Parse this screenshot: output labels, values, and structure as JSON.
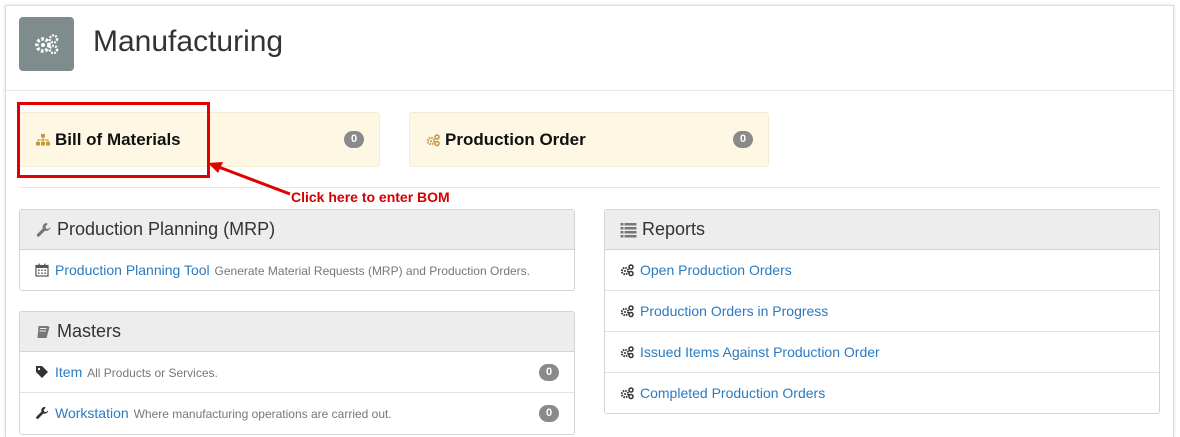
{
  "header": {
    "title": "Manufacturing",
    "icon": "gears-icon"
  },
  "shortcuts": [
    {
      "label": "Bill of Materials",
      "icon": "sitemap-icon",
      "count": "0"
    },
    {
      "label": "Production Order",
      "icon": "gears-icon",
      "count": "0"
    }
  ],
  "annotation": {
    "text": "Click here to enter BOM",
    "color": "#d40000"
  },
  "planning": {
    "title": "Production Planning (MRP)",
    "icon": "wrench-icon",
    "items": [
      {
        "label": "Production Planning Tool",
        "description": "Generate Material Requests (MRP) and Production Orders.",
        "icon": "calendar-icon"
      }
    ]
  },
  "masters": {
    "title": "Masters",
    "icon": "book-icon",
    "items": [
      {
        "label": "Item",
        "description": "All Products or Services.",
        "count": "0",
        "icon": "tag-icon"
      },
      {
        "label": "Workstation",
        "description": "Where manufacturing operations are carried out.",
        "count": "0",
        "icon": "wrench-icon"
      }
    ]
  },
  "reports": {
    "title": "Reports",
    "icon": "list-icon",
    "items": [
      {
        "label": "Open Production Orders",
        "icon": "gears-icon"
      },
      {
        "label": "Production Orders in Progress",
        "icon": "gears-icon"
      },
      {
        "label": "Issued Items Against Production Order",
        "icon": "gears-icon"
      },
      {
        "label": "Completed Production Orders",
        "icon": "gears-icon"
      }
    ]
  },
  "colors": {
    "link": "#2a7bc0",
    "shortcut_bg": "#fdf7e4",
    "highlight": "#e30000",
    "module_icon_bg": "#7f8c8d"
  }
}
